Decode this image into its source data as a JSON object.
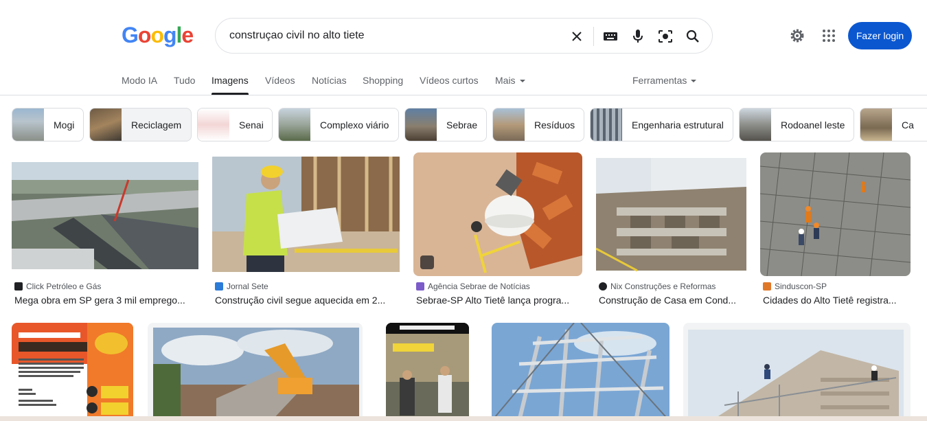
{
  "logo": {
    "letters": [
      "G",
      "o",
      "o",
      "g",
      "l",
      "e"
    ]
  },
  "search": {
    "query": "construçao civil no alto tiete"
  },
  "header": {
    "login_label": "Fazer login"
  },
  "tabs": [
    {
      "label": "Modo IA"
    },
    {
      "label": "Tudo"
    },
    {
      "label": "Imagens"
    },
    {
      "label": "Vídeos"
    },
    {
      "label": "Notícias"
    },
    {
      "label": "Shopping"
    },
    {
      "label": "Vídeos curtos"
    },
    {
      "label": "Mais"
    }
  ],
  "tools_label": "Ferramentas",
  "chips": [
    {
      "label": "Mogi"
    },
    {
      "label": "Reciclagem"
    },
    {
      "label": "Senai"
    },
    {
      "label": "Complexo viário"
    },
    {
      "label": "Sebrae"
    },
    {
      "label": "Resíduos"
    },
    {
      "label": "Engenharia estrutural"
    },
    {
      "label": "Rodoanel leste"
    },
    {
      "label": "Ca"
    }
  ],
  "results": [
    {
      "source": "Click Petróleo e Gás",
      "title": "Mega obra em SP gera 3 mil emprego..."
    },
    {
      "source": "Jornal Sete",
      "title": "Construção civil segue aquecida em 2..."
    },
    {
      "source": "Agência Sebrae de Notícias",
      "title": "Sebrae-SP Alto Tietê lança progra..."
    },
    {
      "source": "Nix Construções e Reformas",
      "title": "Construção de Casa em Cond..."
    },
    {
      "source": "Sinduscon-SP",
      "title": "Cidades do Alto Tietê registra..."
    }
  ],
  "colors": {
    "accent": "#0b57d0",
    "logo_blue": "#4285f4",
    "logo_red": "#ea4335",
    "logo_yellow": "#fbbc05",
    "logo_green": "#34a853"
  }
}
